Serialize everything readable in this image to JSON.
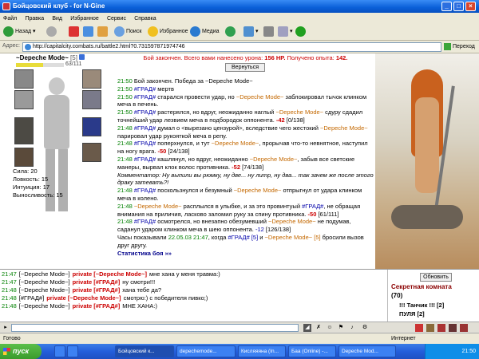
{
  "window": {
    "title": "Бойцовский клуб - for N-Gine"
  },
  "menu": [
    "Файл",
    "Правка",
    "Вид",
    "Избранное",
    "Сервис",
    "Справка"
  ],
  "toolbar": {
    "back": "Назад",
    "search": "Поиск",
    "favorites": "Избранное",
    "media": "Медиа"
  },
  "address": {
    "label": "Адрес:",
    "url": "http://capitalcity.combats.ru/battle2.html?0.731597871974746",
    "go": "Переход"
  },
  "character": {
    "name": "~Depeche Mode~",
    "level": "[5]",
    "hp": "63/111",
    "hp_fraction": 0.57,
    "stats": [
      {
        "label": "Сила:",
        "value": "20"
      },
      {
        "label": "Ловкость:",
        "value": "15"
      },
      {
        "label": "Интуиция:",
        "value": "17"
      },
      {
        "label": "Выносливость:",
        "value": "15"
      }
    ]
  },
  "battle": {
    "result_prefix": "Бой закончен. Всего вами нанесено урона:",
    "damage": "156 HP.",
    "exp_label": "Получено опыта:",
    "exp": "142.",
    "back_button": "Вернуться",
    "log": [
      {
        "t": "21:50",
        "segs": [
          {
            "c": "",
            "s": "Бой закончен. Победа за ~Depeche Mode~"
          }
        ]
      },
      {
        "t": "21:50",
        "segs": [
          {
            "c": "gr",
            "s": "#ГРАД#"
          },
          {
            "c": "",
            "s": " мертв"
          }
        ]
      },
      {
        "t": "21:50",
        "segs": [
          {
            "c": "gr",
            "s": "#ГРАД#"
          },
          {
            "c": "",
            "s": " старался провести удар, но "
          },
          {
            "c": "op",
            "s": "~Depeche Mode~"
          },
          {
            "c": "",
            "s": " заблокировал тычок клинком меча в печень."
          }
        ]
      },
      {
        "t": "21:50",
        "segs": [
          {
            "c": "gr",
            "s": "#ГРАД#"
          },
          {
            "c": "",
            "s": " растерялся, но вдруг, неожиданно наглый "
          },
          {
            "c": "op",
            "s": "~Depeche Mode~"
          },
          {
            "c": "",
            "s": " сдуру сдадил точнейший удар лезвием меча в подбородок оппонента. "
          },
          {
            "c": "dm",
            "s": "-42"
          },
          {
            "c": "",
            "s": " [0/138]"
          }
        ]
      },
      {
        "t": "21:48",
        "segs": [
          {
            "c": "gr",
            "s": "#ГРАД#"
          },
          {
            "c": "",
            "s": " думал о <вырезано цензурой>, вследствие чего жестокий "
          },
          {
            "c": "op",
            "s": "~Depeche Mode~"
          },
          {
            "c": "",
            "s": " парировал удар рукояткой меча в репу."
          }
        ]
      },
      {
        "t": "21:48",
        "segs": [
          {
            "c": "gr",
            "s": "#ГРАД#"
          },
          {
            "c": "",
            "s": " поперхнулся, и тут "
          },
          {
            "c": "op",
            "s": "~Depeche Mode~"
          },
          {
            "c": "",
            "s": ", прорычав что-то невнятное, наступил на ногу врага. "
          },
          {
            "c": "dm",
            "s": "-50"
          },
          {
            "c": "",
            "s": " [24/138]"
          }
        ]
      },
      {
        "t": "21:48",
        "segs": [
          {
            "c": "gr",
            "s": "#ГРАД#"
          },
          {
            "c": "",
            "s": " кашлянул, но вдруг, неожиданно "
          },
          {
            "c": "op",
            "s": "~Depeche Mode~"
          },
          {
            "c": "",
            "s": ", забыв все светские манеры, вырвал клок волос противника. "
          },
          {
            "c": "dm",
            "s": "-52"
          },
          {
            "c": "",
            "s": " [74/138]"
          }
        ]
      },
      {
        "t": "",
        "segs": [
          {
            "c": "kt",
            "s": "Комментатор: Ну выпили вы рюмку, ну две... ну литр, ну два... так зачем же после этого драку затевать?!"
          }
        ]
      },
      {
        "t": "21:48",
        "segs": [
          {
            "c": "gr",
            "s": "#ГРАД#"
          },
          {
            "c": "",
            "s": " поскользнулся и безумный "
          },
          {
            "c": "op",
            "s": "~Depeche Mode~"
          },
          {
            "c": "",
            "s": " отпрыгнул от удара клинком меча в колено."
          }
        ]
      },
      {
        "t": "21:48",
        "segs": [
          {
            "c": "op",
            "s": "~Depeche Mode~"
          },
          {
            "c": "",
            "s": " расплылся в улыбке, и за это провинтуый "
          },
          {
            "c": "gr",
            "s": "#ГРАД#"
          },
          {
            "c": "",
            "s": ", не обращая внимания на приличия, ласково заломил руку за спину противника. "
          },
          {
            "c": "dm",
            "s": "-50"
          },
          {
            "c": "",
            "s": " [61/111]"
          }
        ]
      },
      {
        "t": "21:48",
        "segs": [
          {
            "c": "gr",
            "s": "#ГРАД#"
          },
          {
            "c": "",
            "s": " осмотрелся, но внезапно обезумевший "
          },
          {
            "c": "op",
            "s": "~Depeche Mode~"
          },
          {
            "c": "",
            "s": " не подумав, саданул ударом клинком меча в шею оппонента. "
          },
          {
            "c": "gr",
            "s": "-12"
          },
          {
            "c": "",
            "s": " [126/138]"
          }
        ]
      },
      {
        "t": "",
        "segs": [
          {
            "c": "",
            "s": "Часы показывали "
          },
          {
            "c": "tm",
            "s": "22.05.03 21:47"
          },
          {
            "c": "",
            "s": ", когда "
          },
          {
            "c": "gr",
            "s": "#ГРАД# [5]"
          },
          {
            "c": "",
            "s": " и "
          },
          {
            "c": "op",
            "s": "~Depeche Mode~ [5]"
          },
          {
            "c": "",
            "s": " бросили вызов друг другу."
          }
        ]
      }
    ],
    "stats_link": "Статистика боя »»"
  },
  "chat": {
    "lines": [
      {
        "t": "21:47",
        "who": "[~Depeche Mode~]",
        "pv": "private [~Depeche Mode~]",
        "msg": "мне хана у меня травма:)"
      },
      {
        "t": "21:47",
        "who": "[~Depeche Mode~]",
        "pv": "private [#ГРАД#]",
        "msg": "ну смотри!!!"
      },
      {
        "t": "21:48",
        "who": "[~Depeche Mode~]",
        "pv": "private [#ГРАД#]",
        "msg": "хана тебе да?"
      },
      {
        "t": "21:48",
        "who": "[#ГРАД#]",
        "pv": "private [~Depeche Mode~]",
        "msg": "смотрю:) с победителя пивко;)"
      },
      {
        "t": "21:48",
        "who": "[~Depeche Mode~]",
        "pv": "private [#ГРАД#]",
        "msg": "МНЕ ХАНА:)"
      }
    ],
    "refresh": "Обновить",
    "room_title": "Секретная комната",
    "room_count": "(70)",
    "users": [
      "!!! Танчик !!! [2]",
      "ПУЛЯ [2]"
    ]
  },
  "status": {
    "left": "Готово",
    "right": "Интернет"
  },
  "taskbar": {
    "start": "пуск",
    "tasks": [
      "Бойцовский к...",
      "depechemode...",
      "Кисляяяна (In...",
      "Баа (Online) -...",
      "Depeche Mod..."
    ],
    "clock": "21:50"
  },
  "colors": {
    "titlebar": "#0a5fd8",
    "taskbar": "#245edb",
    "start": "#3a9b2c",
    "damage": "#cc0000",
    "opponent": "#0000aa",
    "self": "#c46800"
  }
}
